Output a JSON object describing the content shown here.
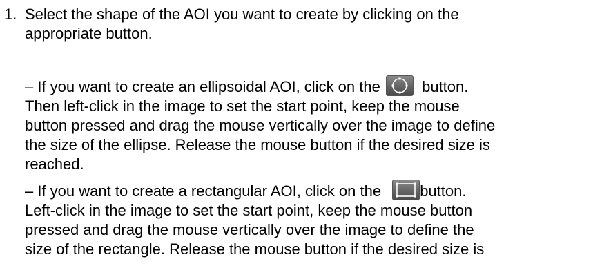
{
  "step": {
    "number": "1.",
    "intro_line1": "Select the shape of the AOI you want to create by clicking on the",
    "intro_line2": "appropriate button."
  },
  "ellipse": {
    "line1_before": "– If you want to create an ellipsoidal AOI, click on the",
    "line1_after": "button.",
    "line2": "Then left-click in the image to set the start point, keep the mouse",
    "line3": "button pressed and drag the mouse vertically over the image to define",
    "line4": "the size of the ellipse. Release the mouse button if the desired size is",
    "line5": "reached.",
    "icon": "ellipse-aoi-icon"
  },
  "rectangle": {
    "line1_before": "– If you want to create a rectangular AOI, click on the",
    "line1_after": "button.",
    "line2": "Left-click in the image to set the start point, keep the mouse button",
    "line3": "pressed and drag the mouse vertically over the image to define the",
    "line4": "size of the rectangle. Release the mouse button if the desired size is",
    "icon": "rectangle-aoi-icon"
  }
}
